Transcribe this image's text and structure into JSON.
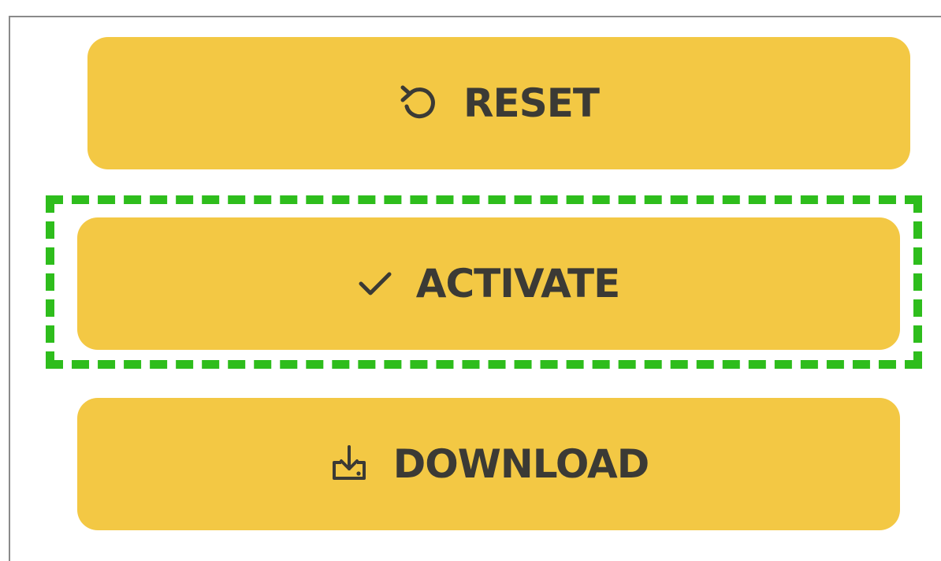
{
  "buttons": {
    "reset": {
      "label": "RESET",
      "icon": "reset-icon"
    },
    "activate": {
      "label": "ACTIVATE",
      "icon": "check-icon",
      "focused": true
    },
    "download": {
      "label": "DOWNLOAD",
      "icon": "download-icon"
    }
  },
  "colors": {
    "button_bg": "#f3c844",
    "button_text": "#3b3a35",
    "focus_ring": "#2ebd1c"
  }
}
